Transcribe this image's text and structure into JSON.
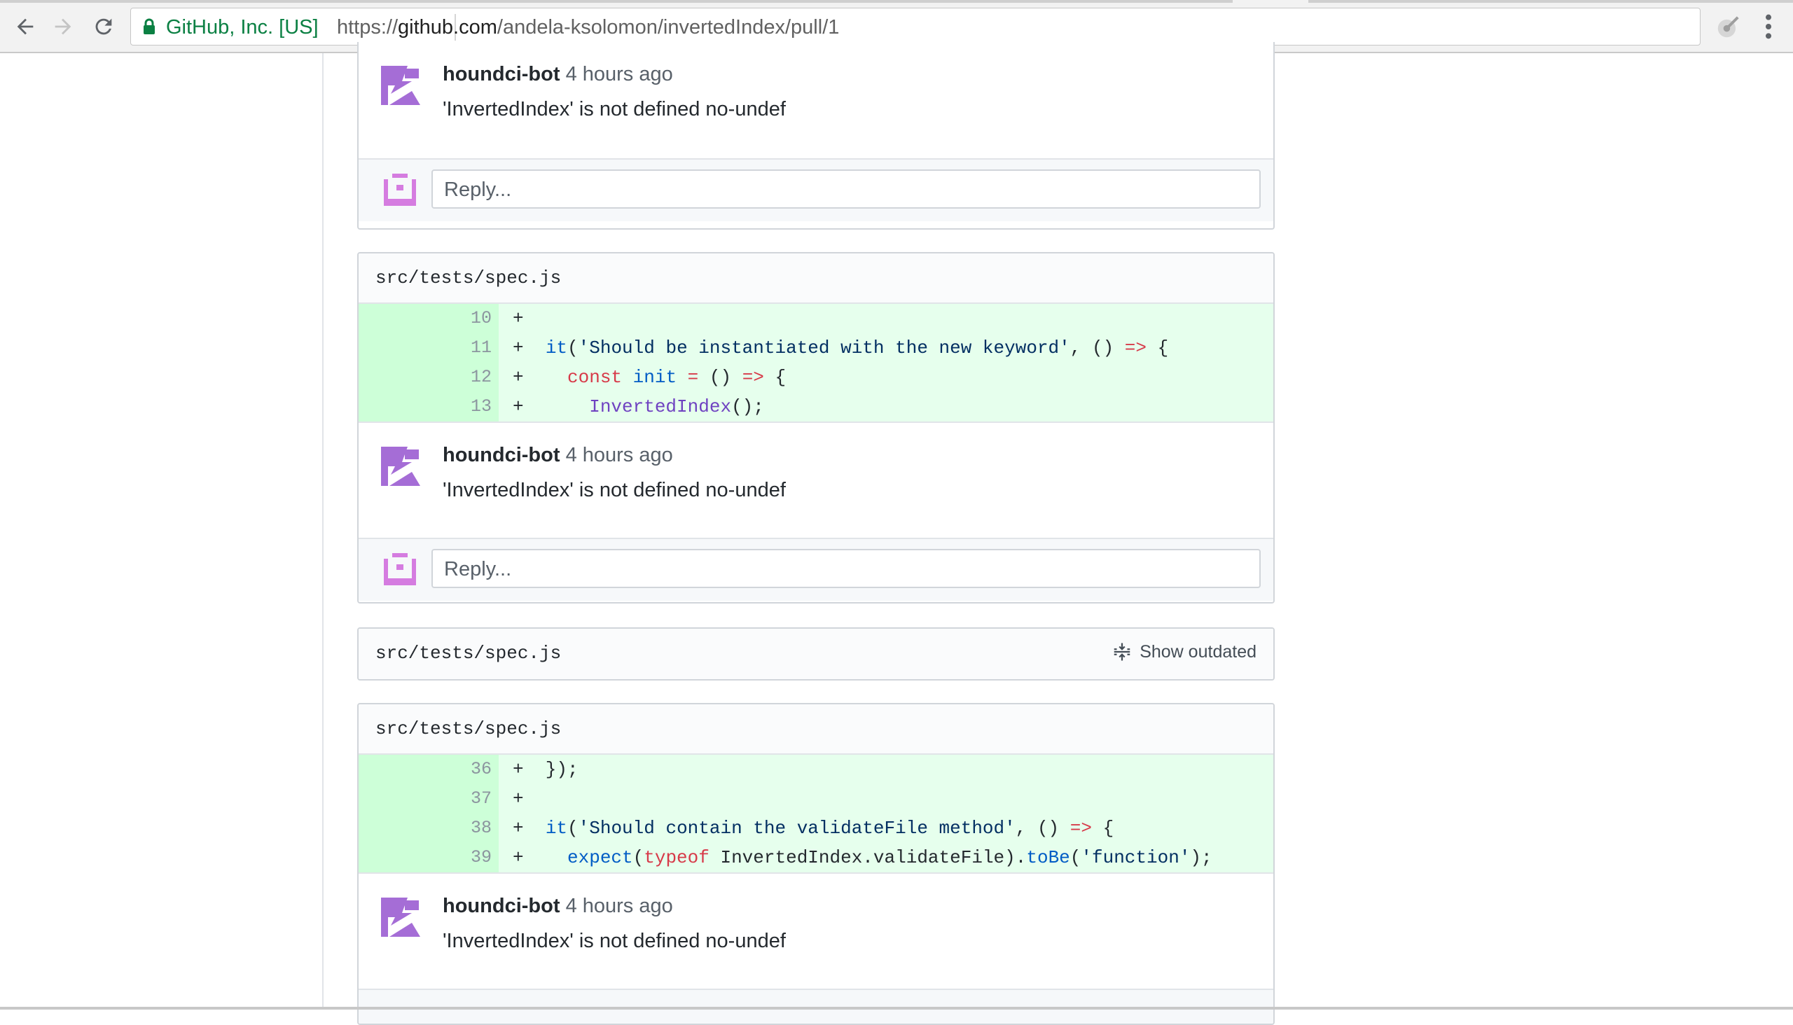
{
  "browser": {
    "secure_label": "GitHub, Inc. [US]",
    "url_scheme": "https://",
    "url_host": "github.com",
    "url_path": "/andela-ksolomon/invertedIndex/pull/1",
    "icons": [
      "back-icon",
      "forward-icon",
      "reload-icon",
      "lock-icon",
      "star-icon",
      "extension-icon",
      "menu-icon"
    ]
  },
  "threads": [
    {
      "comment": {
        "author": "houndci-bot",
        "time": "4 hours ago",
        "body": "'InvertedIndex' is not defined no-undef"
      },
      "reply_placeholder": "Reply..."
    },
    {
      "file_path": "src/tests/spec.js",
      "diff": [
        {
          "line": "10",
          "code": "+"
        },
        {
          "line": "11",
          "code": "+  it('Should be instantiated with the new keyword', () => {"
        },
        {
          "line": "12",
          "code": "+    const init = () => {"
        },
        {
          "line": "13",
          "code": "+      InvertedIndex();"
        }
      ],
      "comment": {
        "author": "houndci-bot",
        "time": "4 hours ago",
        "body": "'InvertedIndex' is not defined no-undef"
      },
      "reply_placeholder": "Reply..."
    },
    {
      "file_path": "src/tests/spec.js",
      "show_outdated_label": "Show outdated"
    },
    {
      "file_path": "src/tests/spec.js",
      "diff": [
        {
          "line": "36",
          "code": "+  });"
        },
        {
          "line": "37",
          "code": "+"
        },
        {
          "line": "38",
          "code": "+  it('Should contain the validateFile method', () => {"
        },
        {
          "line": "39",
          "code": "+    expect(typeof InvertedIndex.validateFile).toBe('function');"
        }
      ],
      "comment": {
        "author": "houndci-bot",
        "time": "4 hours ago",
        "body": "'InvertedIndex' is not defined no-undef"
      }
    }
  ],
  "colors": {
    "avatar_bot": "#a56dd6",
    "avatar_user": "#d57ce0",
    "diff_added_bg": "#e6ffed",
    "diff_gutter_bg": "#cdffd8",
    "secure_green": "#0b8043"
  }
}
